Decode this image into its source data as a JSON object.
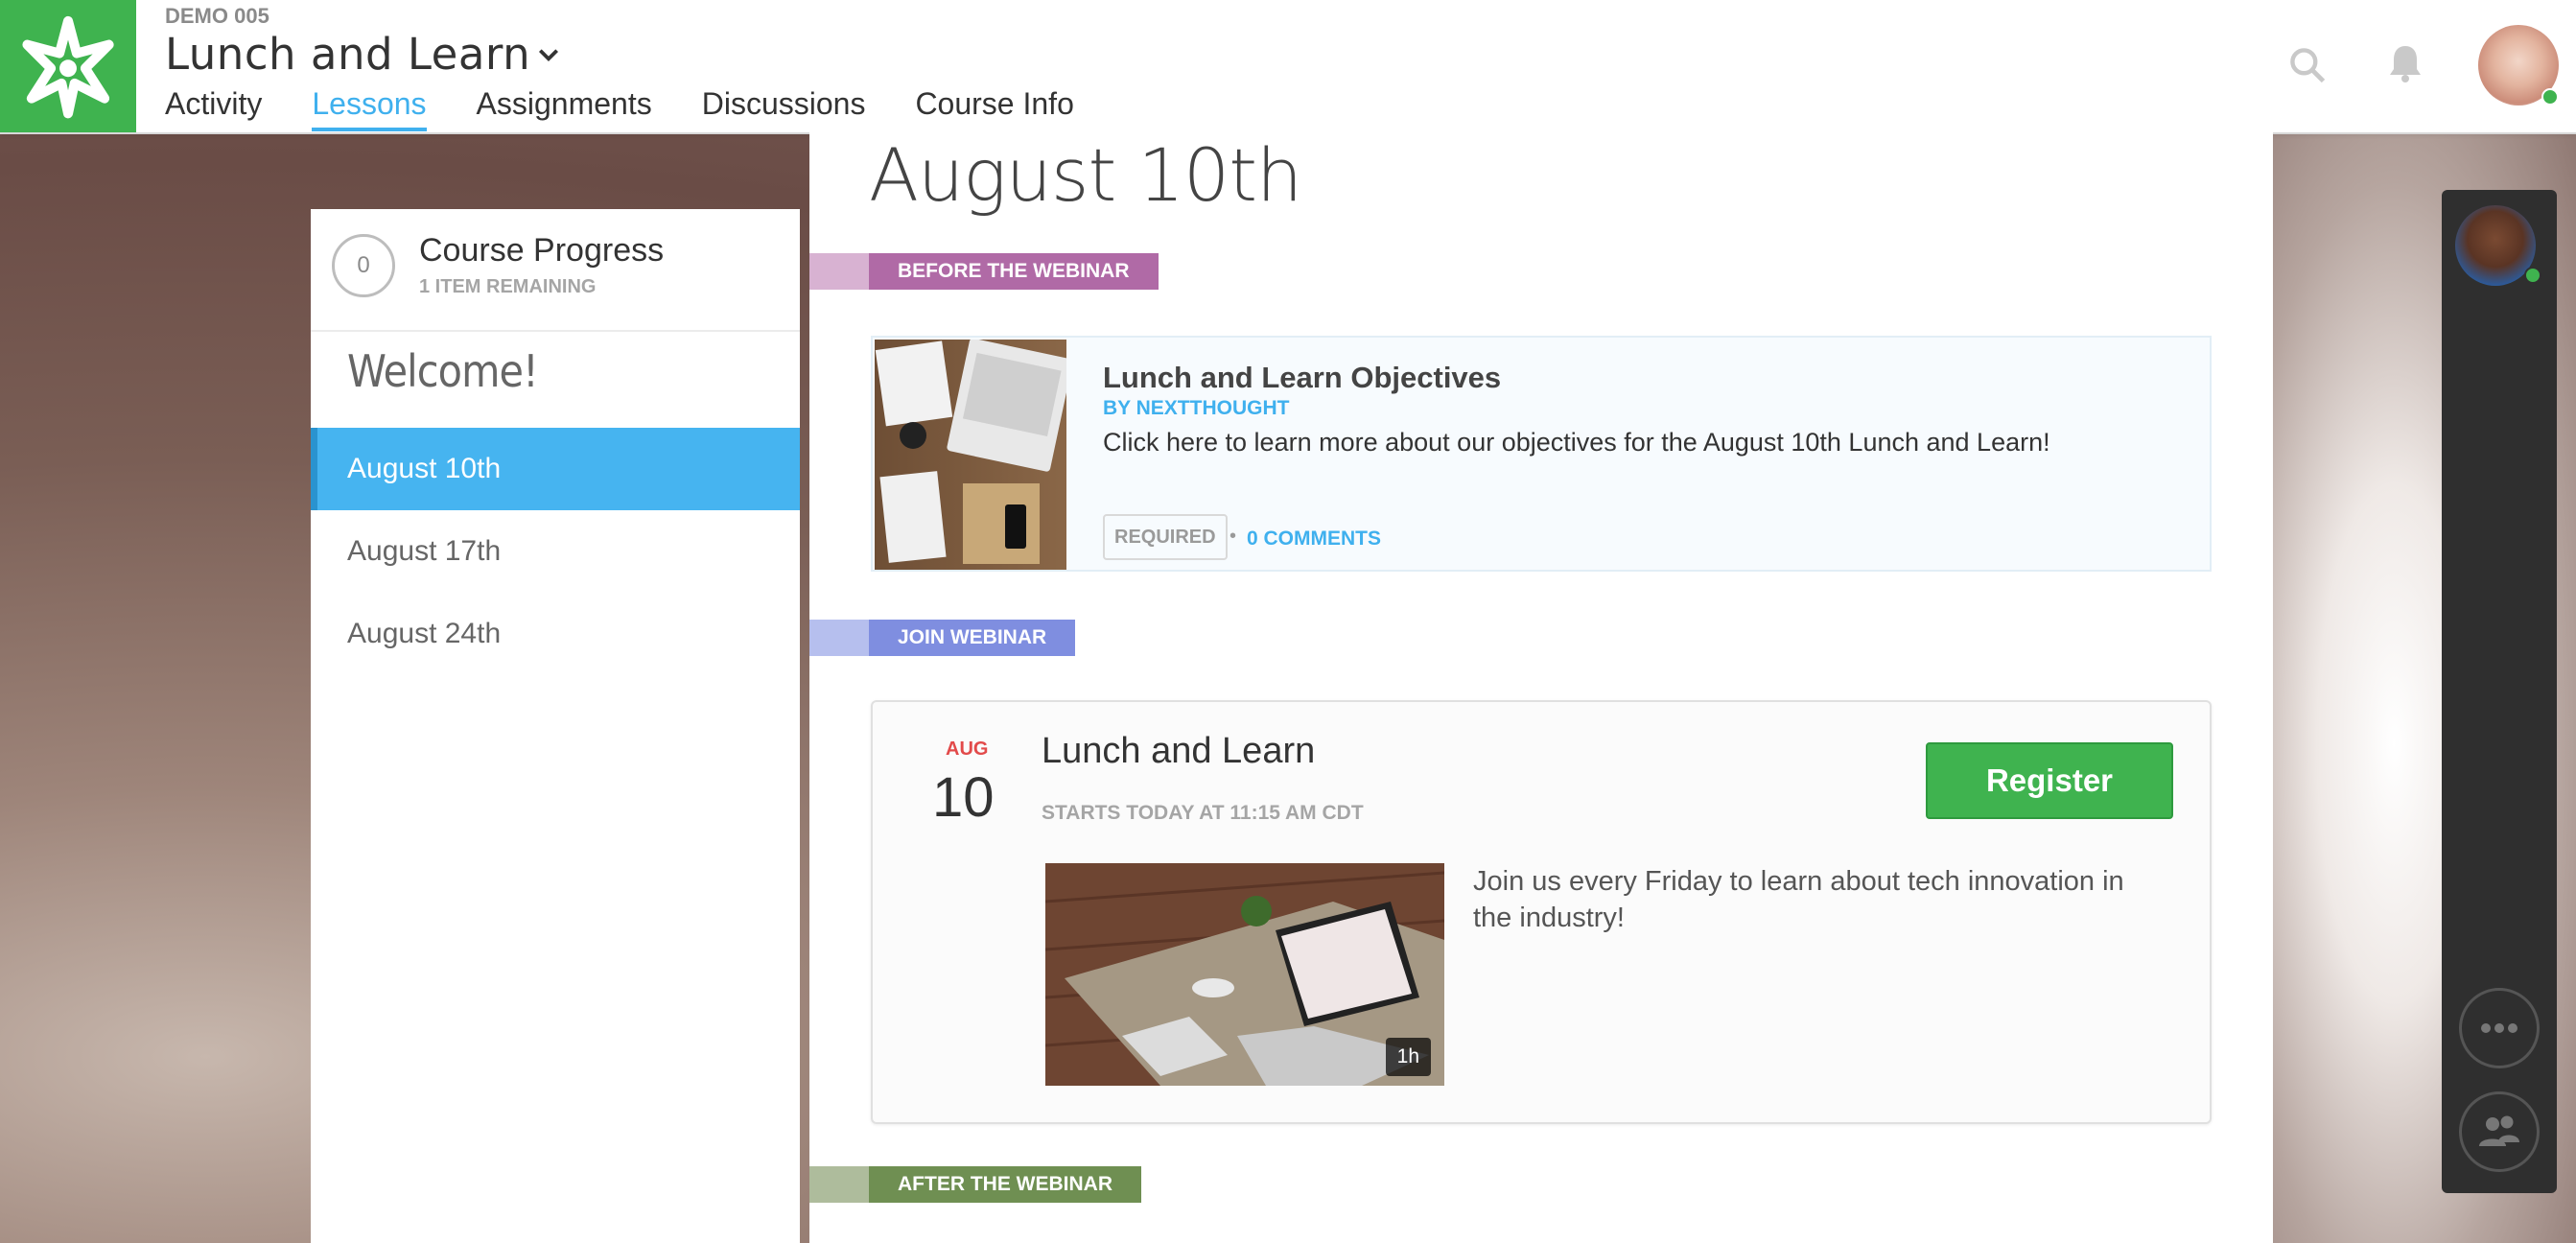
{
  "header": {
    "course_id": "DEMO 005",
    "course_title": "Lunch and Learn",
    "nav": [
      {
        "label": "Activity"
      },
      {
        "label": "Lessons",
        "active": true
      },
      {
        "label": "Assignments"
      },
      {
        "label": "Discussions"
      },
      {
        "label": "Course Info"
      }
    ],
    "icons": [
      "logo-icon",
      "chevron-down-icon",
      "search-icon",
      "bell-icon",
      "avatar"
    ]
  },
  "sidebar": {
    "progress_value": "0",
    "progress_title": "Course Progress",
    "progress_sub": "1 ITEM REMAINING",
    "welcome": "Welcome!",
    "lessons": [
      {
        "label": "August 10th",
        "active": true
      },
      {
        "label": "August 17th"
      },
      {
        "label": "August 24th"
      }
    ]
  },
  "main": {
    "title": "August 10th",
    "sections": {
      "before": {
        "label": "BEFORE THE WEBINAR",
        "color": "#b06aa6",
        "stub_color": "#d8b2d2"
      },
      "join": {
        "label": "JOIN WEBINAR",
        "color": "#7f8ee0",
        "stub_color": "#b6bfee"
      },
      "after": {
        "label": "AFTER THE WEBINAR",
        "color": "#6f8f52",
        "stub_color": "#aebc9c"
      }
    },
    "card": {
      "title": "Lunch and Learn Objectives",
      "by": "BY NEXTTHOUGHT",
      "description": "Click here to learn more about our objectives for the August 10th Lunch and Learn!",
      "badge": "REQUIRED",
      "separator": "•",
      "comments": "0 COMMENTS"
    },
    "event": {
      "month": "AUG",
      "day": "10",
      "title": "Lunch and Learn",
      "time": "STARTS TODAY AT 11:15 AM CDT",
      "register": "Register",
      "duration": "1h",
      "description": "Join us every Friday to learn about tech innovation in the industry!"
    }
  },
  "rail": {
    "icons": [
      "contact-avatar",
      "more-icon",
      "people-icon"
    ]
  },
  "colors": {
    "brand_green": "#3fb34f",
    "accent_blue": "#3fb0ee",
    "active_lesson": "#46b4f0"
  }
}
